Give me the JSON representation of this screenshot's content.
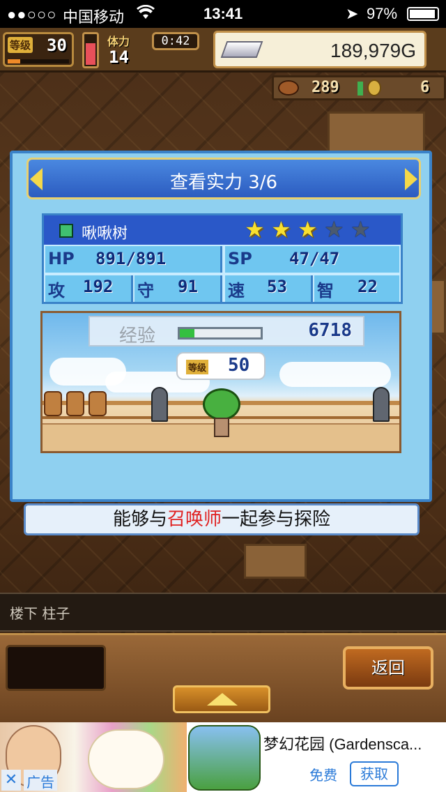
{
  "status_bar": {
    "signal": "●●○○○",
    "carrier": "中国移动",
    "wifi": "wifi-icon",
    "time": "13:41",
    "location_icon": "location-arrow-icon",
    "battery": "97%"
  },
  "hud": {
    "level_label": "等级",
    "level": "30",
    "level_progress_fraction": 0.2,
    "stamina_fraction": 0.7,
    "fatigue_label": "体力",
    "fatigue_value": "14",
    "timer": "0:42",
    "gold": "189,979G",
    "resource_count": "289",
    "resource_count_2": "6"
  },
  "dialog": {
    "title": "查看实力 3/6",
    "name": "啾啾树",
    "stars_filled": 3,
    "stars_total": 5,
    "stats": {
      "hp_label": "HP",
      "hp": "891/891",
      "sp_label": "SP",
      "sp": "47/47",
      "atk_label": "攻",
      "atk": "192",
      "def_label": "守",
      "def": "91",
      "spd_label": "速",
      "spd": "53",
      "int_label": "智",
      "int": "22"
    },
    "exp_label": "经验",
    "exp_value": "6718",
    "exp_fraction": 0.18,
    "bubble_label": "等级",
    "bubble_level": "50",
    "description_pre": "能够与",
    "description_highlight": "召唤师",
    "description_post": "一起参与探险"
  },
  "location": "楼下 柱子",
  "controls": {
    "back_label": "返回"
  },
  "ad": {
    "close": "✕",
    "tag": "广告",
    "title": "梦幻花园 (Gardensca...",
    "free_label": "免费",
    "get_label": "获取"
  },
  "colors": {
    "dialog_bg": "#8fd0f0",
    "header_bg": "#2c5cc0",
    "highlight": "#e02020",
    "exp_fill": "#34c040"
  }
}
